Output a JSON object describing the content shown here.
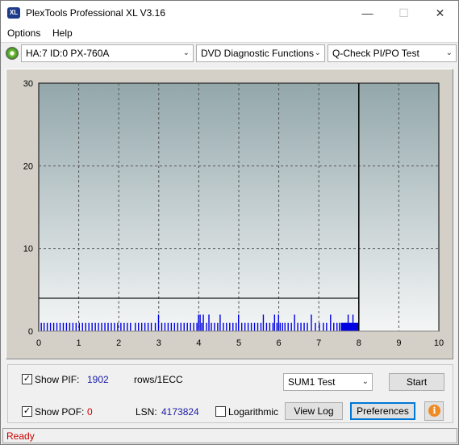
{
  "window": {
    "title": "PlexTools Professional XL V3.16",
    "app_icon_text": "XL",
    "min_glyph": "—",
    "max_glyph": "☐",
    "close_glyph": "✕"
  },
  "menu": {
    "options": "Options",
    "help": "Help"
  },
  "toolbar": {
    "drive": "HA:7 ID:0  PX-760A",
    "function": "DVD Diagnostic Functions",
    "test": "Q-Check PI/PO Test",
    "arrow": "⌄"
  },
  "chart_data": {
    "type": "bar",
    "xlim": [
      0,
      10
    ],
    "ylim": [
      0,
      30
    ],
    "x_ticks": [
      "0",
      "1",
      "2",
      "3",
      "4",
      "5",
      "6",
      "7",
      "8",
      "9",
      "10"
    ],
    "y_ticks": [
      "0",
      "10",
      "20",
      "30"
    ],
    "threshold": 4,
    "end_marker_x": 8,
    "grid": true,
    "colors": {
      "bars": "#0000e0",
      "threshold_line": "#000000",
      "plot_top": "#93a7ab",
      "plot_bottom": "#f4f6f6"
    },
    "series": [
      {
        "values": [
          [
            0.05,
            1
          ],
          [
            0.12,
            1
          ],
          [
            0.2,
            1
          ],
          [
            0.28,
            1
          ],
          [
            0.36,
            1
          ],
          [
            0.44,
            1
          ],
          [
            0.52,
            1
          ],
          [
            0.6,
            1
          ],
          [
            0.68,
            1
          ],
          [
            0.76,
            1
          ],
          [
            0.84,
            1
          ],
          [
            0.92,
            1
          ],
          [
            1.0,
            1
          ],
          [
            1.08,
            1
          ],
          [
            1.16,
            1
          ],
          [
            1.24,
            1
          ],
          [
            1.32,
            1
          ],
          [
            1.4,
            1
          ],
          [
            1.48,
            1
          ],
          [
            1.56,
            1
          ],
          [
            1.64,
            1
          ],
          [
            1.72,
            1
          ],
          [
            1.8,
            1
          ],
          [
            1.88,
            1
          ],
          [
            1.96,
            1
          ],
          [
            2.04,
            1
          ],
          [
            2.12,
            1
          ],
          [
            2.2,
            1
          ],
          [
            2.28,
            1
          ],
          [
            2.4,
            1
          ],
          [
            2.48,
            1
          ],
          [
            2.56,
            1
          ],
          [
            2.64,
            1
          ],
          [
            2.72,
            1
          ],
          [
            2.8,
            1
          ],
          [
            2.9,
            1
          ],
          [
            2.98,
            2
          ],
          [
            3.06,
            1
          ],
          [
            3.14,
            1
          ],
          [
            3.22,
            1
          ],
          [
            3.3,
            1
          ],
          [
            3.38,
            1
          ],
          [
            3.46,
            1
          ],
          [
            3.54,
            1
          ],
          [
            3.62,
            1
          ],
          [
            3.7,
            1
          ],
          [
            3.78,
            1
          ],
          [
            3.86,
            1
          ],
          [
            3.94,
            1
          ],
          [
            3.98,
            2
          ],
          [
            4.02,
            2
          ],
          [
            4.06,
            1
          ],
          [
            4.1,
            2
          ],
          [
            4.18,
            1
          ],
          [
            4.24,
            2
          ],
          [
            4.3,
            1
          ],
          [
            4.38,
            1
          ],
          [
            4.46,
            1
          ],
          [
            4.52,
            2
          ],
          [
            4.6,
            1
          ],
          [
            4.68,
            1
          ],
          [
            4.76,
            1
          ],
          [
            4.84,
            1
          ],
          [
            4.92,
            1
          ],
          [
            4.98,
            2
          ],
          [
            5.06,
            1
          ],
          [
            5.14,
            1
          ],
          [
            5.22,
            1
          ],
          [
            5.3,
            1
          ],
          [
            5.38,
            1
          ],
          [
            5.46,
            1
          ],
          [
            5.54,
            1
          ],
          [
            5.6,
            2
          ],
          [
            5.68,
            1
          ],
          [
            5.76,
            1
          ],
          [
            5.84,
            1
          ],
          [
            5.88,
            2
          ],
          [
            5.94,
            1
          ],
          [
            5.98,
            2
          ],
          [
            6.02,
            1
          ],
          [
            6.08,
            1
          ],
          [
            6.14,
            1
          ],
          [
            6.22,
            1
          ],
          [
            6.3,
            1
          ],
          [
            6.38,
            2
          ],
          [
            6.46,
            1
          ],
          [
            6.54,
            1
          ],
          [
            6.62,
            1
          ],
          [
            6.7,
            1
          ],
          [
            6.8,
            2
          ],
          [
            6.9,
            1
          ],
          [
            7.0,
            1
          ],
          [
            7.1,
            1
          ],
          [
            7.18,
            1
          ],
          [
            7.28,
            2
          ],
          [
            7.36,
            1
          ],
          [
            7.44,
            1
          ],
          [
            7.5,
            1
          ],
          [
            7.56,
            1
          ],
          [
            7.62,
            1
          ],
          [
            7.66,
            1
          ],
          [
            7.7,
            1
          ],
          [
            7.72,
            2
          ],
          [
            7.78,
            1
          ],
          [
            7.84,
            2
          ],
          [
            7.9,
            1
          ],
          [
            7.96,
            1
          ]
        ]
      }
    ]
  },
  "controls": {
    "show_pif_label": "Show PIF:",
    "pif_value": "1902",
    "rows_label": "rows/1ECC",
    "show_pof_label": "Show POF:",
    "pof_value": "0",
    "lsn_label": "LSN:",
    "lsn_value": "4173824",
    "logarithmic_label": "Logarithmic",
    "sum_test": "SUM1 Test",
    "start": "Start",
    "view_log": "View Log",
    "preferences": "Preferences",
    "info_glyph": "i",
    "check_glyph": "✓"
  },
  "status": {
    "text": "Ready"
  }
}
